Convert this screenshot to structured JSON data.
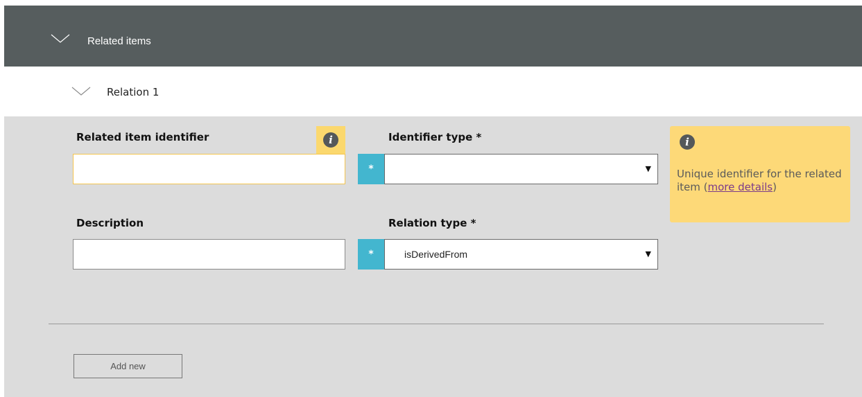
{
  "section": {
    "title": "Related items",
    "icon": "chevron-down-icon"
  },
  "relation": {
    "title": "Relation 1",
    "icon": "chevron-down-icon"
  },
  "fields": {
    "related_item_identifier": {
      "label": "Related item identifier",
      "value": "",
      "info_icon": "info-icon"
    },
    "identifier_type": {
      "label": "Identifier type *",
      "required_marker": "*",
      "selected": "",
      "dropdown_icon": "triangle-down-icon"
    },
    "description": {
      "label": "Description",
      "value": ""
    },
    "relation_type": {
      "label": "Relation type *",
      "required_marker": "*",
      "selected": "isDerivedFrom",
      "dropdown_icon": "triangle-down-icon"
    }
  },
  "help": {
    "icon": "info-icon",
    "text": "Unique identifier for the related item (",
    "link_text": "more details",
    "text_end": ")"
  },
  "actions": {
    "add_new_label": "Add new"
  },
  "colors": {
    "header_bg": "#565d5e",
    "panel_bg": "#dcdcdc",
    "accent_yellow": "#fdd978",
    "required_blue": "#43b6cf",
    "link_purple": "#7b3a8a"
  }
}
